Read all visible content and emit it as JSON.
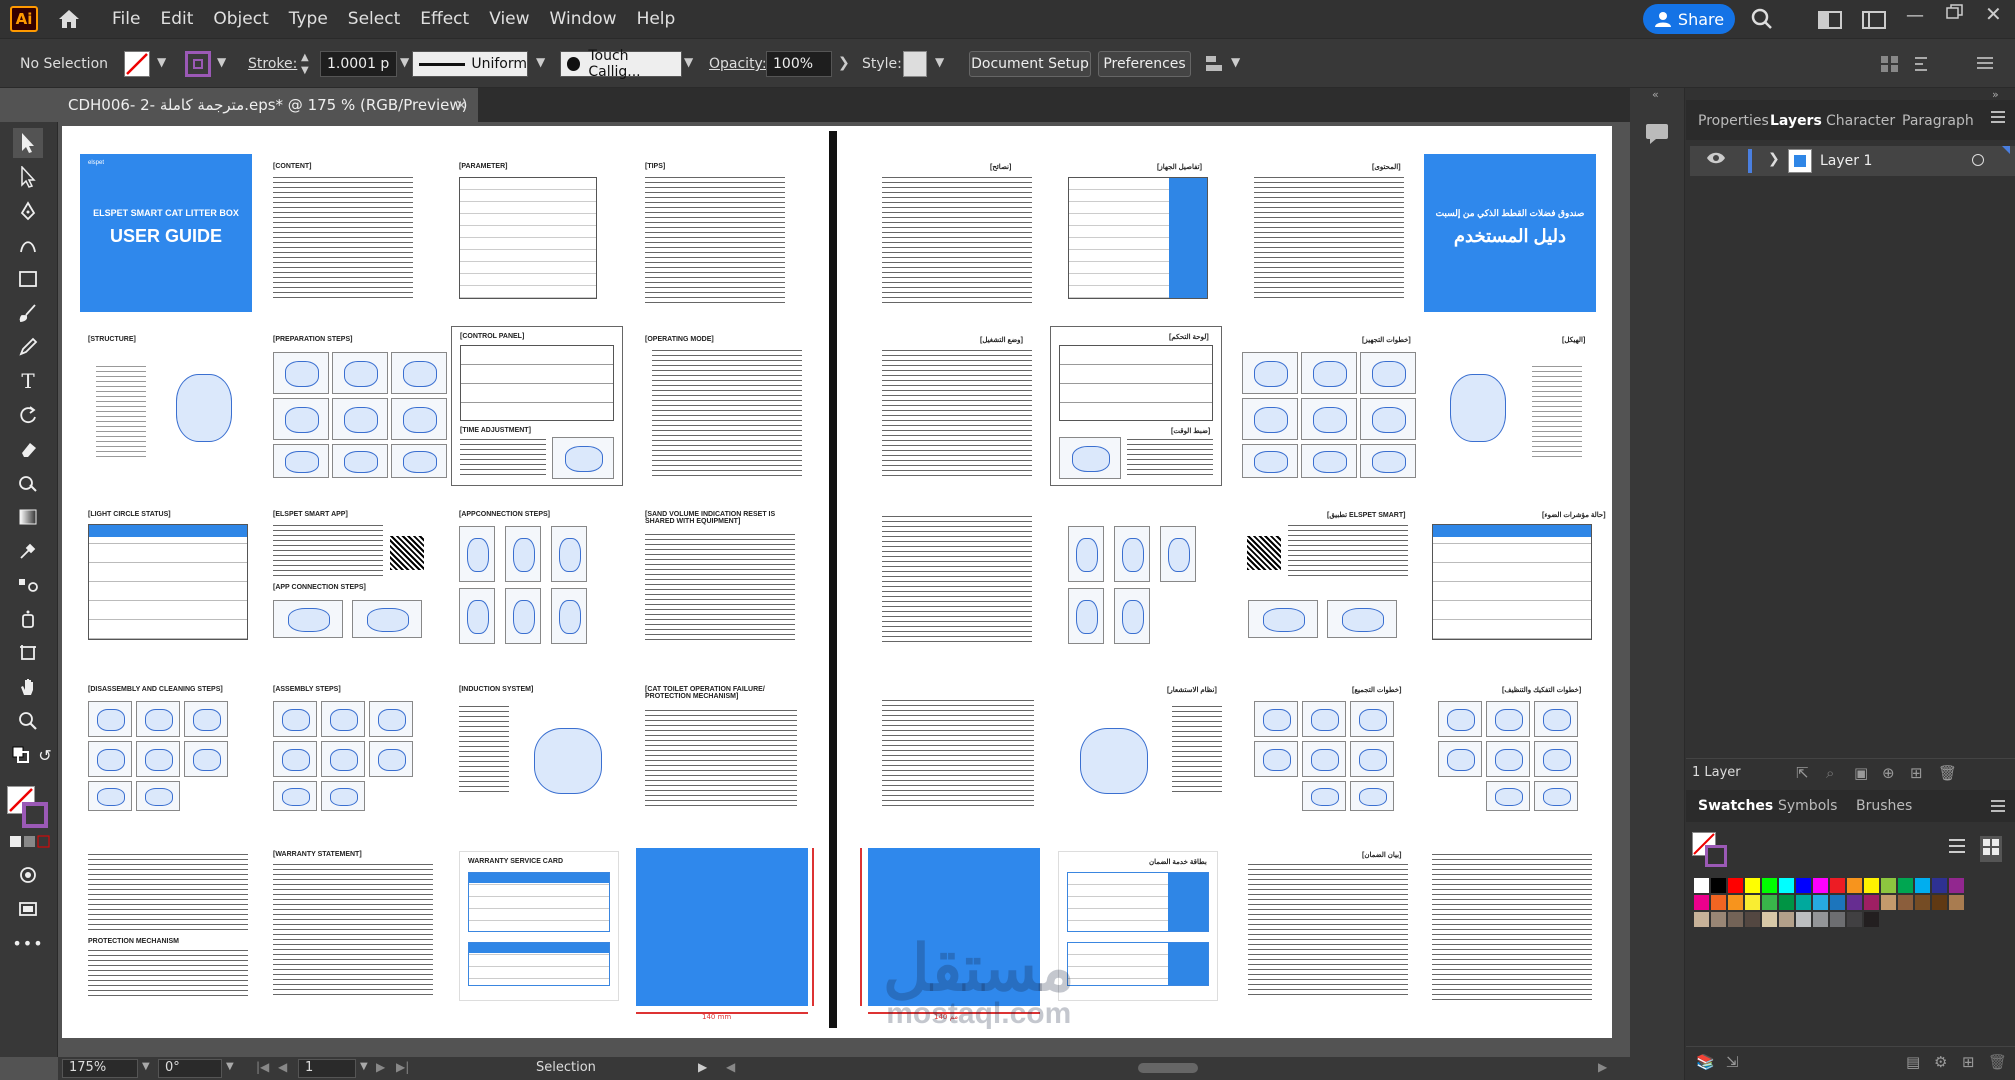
{
  "app": {
    "logo": "Ai",
    "menus": [
      "File",
      "Edit",
      "Object",
      "Type",
      "Select",
      "Effect",
      "View",
      "Window",
      "Help"
    ],
    "share_label": "Share"
  },
  "control_bar": {
    "selection_label": "No Selection",
    "stroke_label": "Stroke:",
    "stroke_value": "1.0001 p",
    "profile_label": "Uniform",
    "brush_label": "Touch Callig...",
    "opacity_label": "Opacity:",
    "opacity_value": "100%",
    "style_label": "Style:",
    "document_setup": "Document Setup",
    "preferences": "Preferences"
  },
  "document_tab": {
    "title": "CDH006- 2- مترجمة كاملة.eps* @ 175 % (RGB/Preview)",
    "close": "×"
  },
  "status_bar": {
    "zoom": "175%",
    "rotation": "0°",
    "artboard": "1",
    "tool": "Selection"
  },
  "panels": {
    "tabs": [
      "Properties",
      "Layers",
      "Character",
      "Paragraph"
    ],
    "active_tab": "Layers",
    "layer_name": "Layer 1",
    "layer_count": "1 Layer",
    "swatch_tabs": [
      "Swatches",
      "Symbols",
      "Brushes"
    ]
  },
  "manual_en": {
    "brand": "elspet",
    "cover_title": "ELSPET SMART CAT LITTER BOX",
    "cover_subtitle": "USER GUIDE",
    "sections": {
      "content": "[CONTENT]",
      "parameter": "[PARAMETER]",
      "tips": "[TIPS]",
      "structure": "[STRUCTURE]",
      "preparation": "[PREPARATION STEPS]",
      "control_panel": "[CONTROL PANEL]",
      "operating_mode": "[OPERATING MODE]",
      "time_adjustment": "[TIME ADJUSTMENT]",
      "light_circle": "[LIGHT CIRCLE STATUS]",
      "smart_app": "[ELSPET SMART APP]",
      "app_connection": "[APPCONNECTION STEPS]",
      "app_connection_2": "[APP CONNECTION STEPS]",
      "sand_volume": "[SAND VOLUME INDICATION RESET IS SHARED WITH EQUIPMENT]",
      "disassembly": "[DISASSEMBLY AND CLEANING STEPS]",
      "assembly": "[ASSEMBLY STEPS]",
      "induction": "[INDUCTION SYSTEM]",
      "failure": "[CAT TOILET OPERATION FAILURE/ PROTECTION MECHANISM]",
      "warranty": "[WARRANTY STATEMENT]",
      "warranty_card": "WARRANTY SERVICE CARD",
      "protection": "PROTECTION MECHANISM"
    },
    "dimension": "140 mm"
  },
  "manual_ar": {
    "cover_title": "صندوق فضلات القطط الذكي من إلسبت",
    "cover_subtitle": "دليل المستخدم",
    "sections": {
      "tips": "[نصائح]",
      "parameter": "[تفاصيل الجهاز]",
      "content": "[المحتوى]",
      "operating_mode": "[وضع التشغيل]",
      "control_panel": "[لوحة التحكم]",
      "preparation": "[خطوات التجهيز]",
      "structure": "[الهيكل]",
      "time_adjustment": "[ضبط الوقت]",
      "smart_app": "[تطبيق ELSPET SMART]",
      "light_circle": "[حالة مؤشرات الضوء]",
      "induction": "[نظام الاستشعار]",
      "assembly": "[خطوات التجميع]",
      "disassembly": "[خطوات التفكيك والتنظيف]",
      "warranty": "[بيان الضمان]",
      "warranty_card": "بطاقة خدمة الضمان"
    },
    "dimension": "140 مم"
  },
  "watermark": {
    "arabic": "مستقل",
    "latin": "mostaql.com"
  },
  "swatch_colors": [
    "#ffffff",
    "#000000",
    "#ff0000",
    "#ffff00",
    "#00ff00",
    "#00ffff",
    "#0000ff",
    "#ff00ff",
    "#ed1c24",
    "#f7941d",
    "#fff200",
    "#8dc63f",
    "#00a651",
    "#00aeef",
    "#2e3192",
    "#92278f",
    "#ec008c",
    "#f26522",
    "#f7941d",
    "#f9ed32",
    "#39b54a",
    "#009444",
    "#00a99d",
    "#27aae1",
    "#1c75bc",
    "#662d91",
    "#9e1f63",
    "#c49a6c",
    "#8b5e3c",
    "#754c24",
    "#603913",
    "#a97c50",
    "#c7b299",
    "#998675",
    "#736357",
    "#534741",
    "#d7c8a7",
    "#b3a08a",
    "#bcbec0",
    "#939598",
    "#6d6e71",
    "#414042",
    "#231f20"
  ]
}
